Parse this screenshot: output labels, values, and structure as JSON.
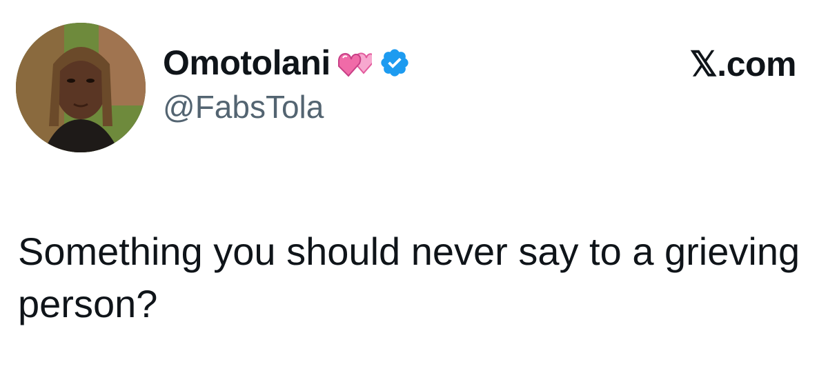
{
  "author": {
    "display_name": "Omotolani",
    "name_emoji": "revolving-hearts-emoji",
    "verified_badge": "verified-badge-icon",
    "handle": "@FabsTola"
  },
  "brand": {
    "label": "𝕏.com"
  },
  "tweet": {
    "text": "Something you should never say to a grieving person?"
  },
  "colors": {
    "text_primary": "#0f1419",
    "text_secondary": "#536471",
    "verified_blue": "#1d9bf0",
    "heart_pink": "#f06ba8"
  }
}
